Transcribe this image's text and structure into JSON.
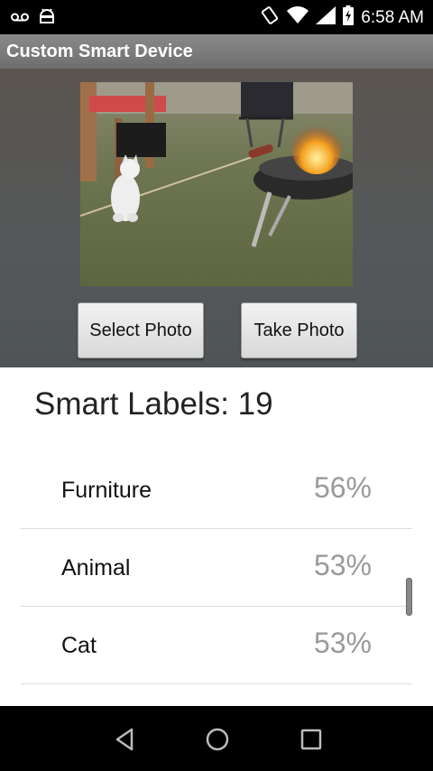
{
  "status_bar": {
    "time": "6:58 AM",
    "icons": [
      "voicemail-icon",
      "android-icon",
      "vibrate-icon",
      "wifi-icon",
      "signal-icon",
      "battery-charging-icon"
    ]
  },
  "app": {
    "title": "Custom Smart Device"
  },
  "buttons": {
    "select_photo": "Select Photo",
    "take_photo": "Take Photo"
  },
  "labels": {
    "heading": "Smart Labels: 19",
    "items": [
      {
        "name": "Furniture",
        "percent": "56%"
      },
      {
        "name": "Animal",
        "percent": "53%"
      },
      {
        "name": "Cat",
        "percent": "53%"
      }
    ]
  },
  "nav": {
    "icons": [
      "back-icon",
      "home-icon",
      "recents-icon"
    ]
  },
  "colors": {
    "status_bar": "#000000",
    "action_bar": "#7c7c7c",
    "panel": "#55585a",
    "percent_text": "#9a9a9a"
  }
}
